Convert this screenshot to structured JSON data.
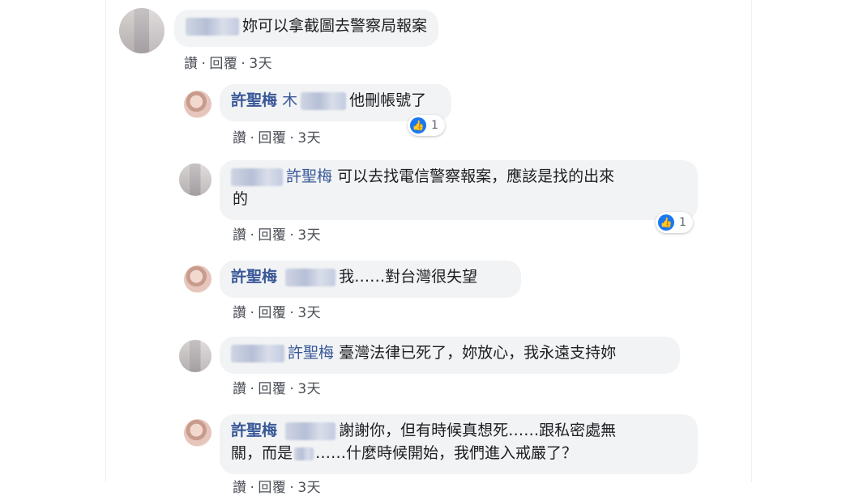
{
  "comments": [
    {
      "text": "妳可以拿截圖去警察局報案",
      "actions": {
        "like": "讚",
        "dot1": "·",
        "reply": "回覆",
        "dot2": "·",
        "time": "3天"
      }
    },
    {
      "name": "許聖梅",
      "prefix": "木",
      "text": "他刪帳號了",
      "reactions": "1",
      "actions": {
        "like": "讚",
        "dot1": "·",
        "reply": "回覆",
        "dot2": "·",
        "time": "3天"
      }
    },
    {
      "name": "許聖梅",
      "text": "可以去找電信警察報案，應該是找的出來",
      "text2": "的",
      "reactions": "1",
      "actions": {
        "like": "讚",
        "dot1": "·",
        "reply": "回覆",
        "dot2": "·",
        "time": "3天"
      }
    },
    {
      "name": "許聖梅",
      "text": "我……對台灣很失望",
      "actions": {
        "like": "讚",
        "dot1": "·",
        "reply": "回覆",
        "dot2": "·",
        "time": "3天"
      }
    },
    {
      "name": "許聖梅",
      "text": "臺灣法律已死了，妳放心，我永遠支持妳",
      "actions": {
        "like": "讚",
        "dot1": "·",
        "reply": "回覆",
        "dot2": "·",
        "time": "3天"
      }
    },
    {
      "name": "許聖梅",
      "text": "謝謝你，但有時候真想死……跟私密處無",
      "text2a": "關，而是",
      "text2b": "……什麼時候開始，我們進入戒嚴了？",
      "actions": {
        "like": "讚",
        "dot1": "·",
        "reply": "回覆",
        "dot2": "·",
        "time": "3天"
      }
    }
  ],
  "colors": {
    "name": "#385898",
    "bubble": "#f2f3f5",
    "like": "#1877f2"
  }
}
